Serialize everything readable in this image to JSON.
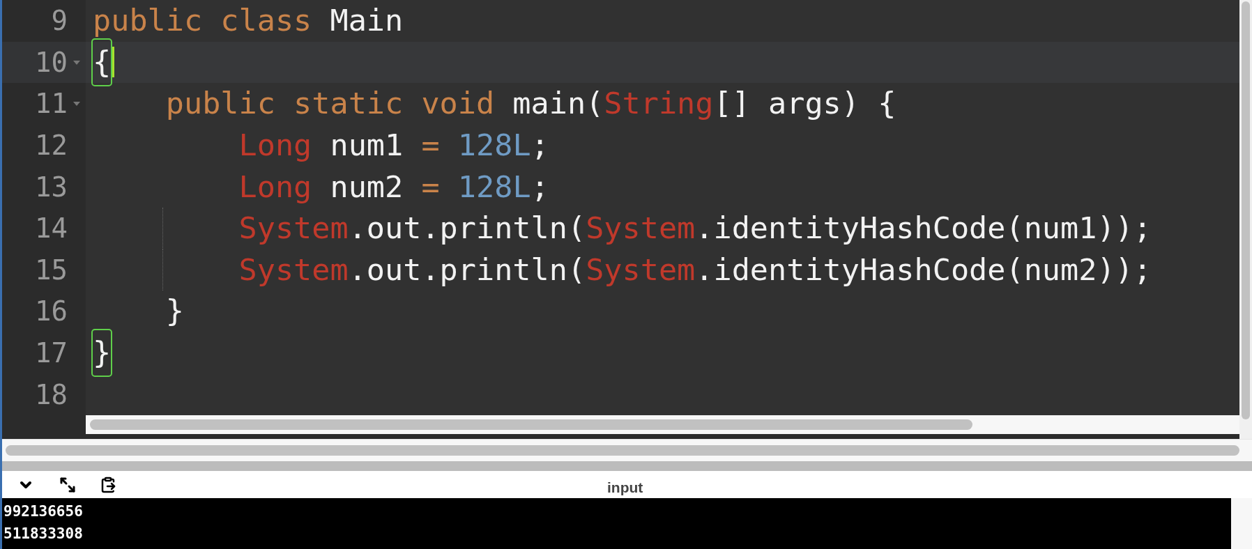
{
  "editor": {
    "lines": [
      {
        "number": "9",
        "active": false,
        "foldable": false,
        "guide": false,
        "tokens": [
          {
            "kind": "keyword",
            "text": "public class "
          },
          {
            "kind": "plain",
            "text": "Main"
          }
        ]
      },
      {
        "number": "10",
        "active": true,
        "foldable": true,
        "guide": false,
        "tokens": [
          {
            "kind": "plain",
            "text": "{",
            "matched": true
          }
        ]
      },
      {
        "number": "11",
        "active": false,
        "foldable": true,
        "guide": false,
        "tokens": [
          {
            "kind": "keyword",
            "text": "    public static void "
          },
          {
            "kind": "plain",
            "text": "main("
          },
          {
            "kind": "type",
            "text": "String"
          },
          {
            "kind": "plain",
            "text": "[] args) {"
          }
        ]
      },
      {
        "number": "12",
        "active": false,
        "foldable": false,
        "guide": false,
        "tokens": [
          {
            "kind": "type",
            "text": "        Long"
          },
          {
            "kind": "plain",
            "text": " num1 "
          },
          {
            "kind": "keyword",
            "text": "= "
          },
          {
            "kind": "number",
            "text": "128L"
          },
          {
            "kind": "plain",
            "text": ";"
          }
        ]
      },
      {
        "number": "13",
        "active": false,
        "foldable": false,
        "guide": false,
        "tokens": [
          {
            "kind": "type",
            "text": "        Long"
          },
          {
            "kind": "plain",
            "text": " num2 "
          },
          {
            "kind": "keyword",
            "text": "= "
          },
          {
            "kind": "number",
            "text": "128L"
          },
          {
            "kind": "plain",
            "text": ";"
          }
        ]
      },
      {
        "number": "14",
        "active": false,
        "foldable": false,
        "guide": true,
        "tokens": [
          {
            "kind": "type",
            "text": "System"
          },
          {
            "kind": "plain",
            "text": ".out.println("
          },
          {
            "kind": "type",
            "text": "System"
          },
          {
            "kind": "plain",
            "text": ".identityHashCode(num1));"
          }
        ]
      },
      {
        "number": "15",
        "active": false,
        "foldable": false,
        "guide": true,
        "tokens": [
          {
            "kind": "type",
            "text": "System"
          },
          {
            "kind": "plain",
            "text": ".out.println("
          },
          {
            "kind": "type",
            "text": "System"
          },
          {
            "kind": "plain",
            "text": ".identityHashCode(num2));"
          }
        ]
      },
      {
        "number": "16",
        "active": false,
        "foldable": false,
        "guide": false,
        "tokens": [
          {
            "kind": "plain",
            "text": "    }"
          }
        ]
      },
      {
        "number": "17",
        "active": false,
        "foldable": false,
        "guide": false,
        "tokens": [
          {
            "kind": "plain",
            "text": "}",
            "matched": true
          }
        ]
      },
      {
        "number": "18",
        "active": false,
        "foldable": false,
        "guide": false
      }
    ]
  },
  "panel": {
    "title": "input"
  },
  "console": {
    "lines": [
      "992136656",
      "511833308"
    ]
  }
}
